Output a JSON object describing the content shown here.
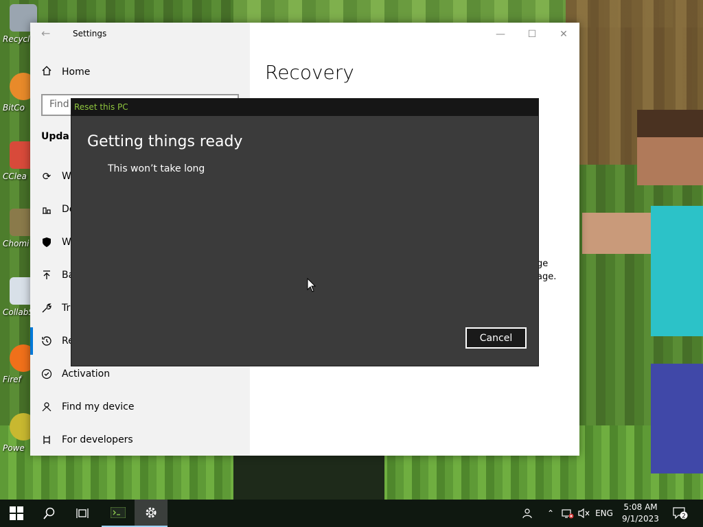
{
  "desktop": {
    "icons": [
      {
        "label": "Recycl",
        "color": "#9aa5b0"
      },
      {
        "label": "BitCo",
        "color": "#e88a2a"
      },
      {
        "label": "CClea",
        "color": "#d84a3a"
      },
      {
        "label": "Chomi",
        "color": "#8a7a4a"
      },
      {
        "label": "CollabS",
        "color": "#d8e0e8"
      },
      {
        "label": "Firef",
        "color": "#f0701a"
      },
      {
        "label": "Powe",
        "color": "#c8b830"
      }
    ]
  },
  "settings": {
    "window_title": "Settings",
    "minimize": "—",
    "maximize": "☐",
    "close": "✕",
    "nav": {
      "home_label": "Home",
      "search_placeholder": "Find",
      "section": "Upda",
      "items": [
        {
          "label": "W",
          "icon": "sync-icon"
        },
        {
          "label": "De",
          "icon": "delivery-icon"
        },
        {
          "label": "W",
          "icon": "shield-icon"
        },
        {
          "label": "Ba",
          "icon": "backup-arrow-icon"
        },
        {
          "label": "Tr",
          "icon": "wrench-icon"
        },
        {
          "label": "Re",
          "icon": "history-icon"
        },
        {
          "label": "Activation",
          "icon": "check-circle-icon"
        },
        {
          "label": "Find my device",
          "icon": "person-search-icon"
        },
        {
          "label": "For developers",
          "icon": "developer-icon"
        }
      ]
    },
    "content": {
      "title": "Recovery",
      "fragment_1": "ge",
      "fragment_2": "age."
    }
  },
  "dialog": {
    "title": "Reset this PC",
    "heading": "Getting things ready",
    "subtext": "This won’t take long",
    "cancel_label": "Cancel"
  },
  "taskbar": {
    "language": "ENG",
    "time": "5:08 AM",
    "date": "9/1/2023",
    "notification_count": "2"
  },
  "colors": {
    "accent": "#0078d7",
    "dialog_bg": "#3b3b3b",
    "dialog_title": "#8fc63f"
  }
}
